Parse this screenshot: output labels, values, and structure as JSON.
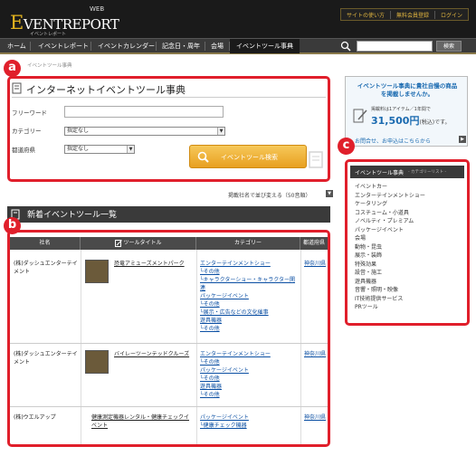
{
  "header": {
    "logo_web": "WEB",
    "logo_e": "E",
    "logo_rest": "VENT",
    "logo_report": "REPORT",
    "logo_tagline": "イベントレポート",
    "util_links": [
      "サイトの使い方",
      "無料会員登録",
      "ログイン"
    ]
  },
  "nav": {
    "items": [
      "ホーム",
      "イベントレポート",
      "イベントカレンダー",
      "記念日・周年",
      "会場",
      "イベントツール事典"
    ],
    "search_button": "検索"
  },
  "breadcrumb": "イベントツール事典",
  "markers": {
    "a": "a",
    "b": "b",
    "c": "c"
  },
  "search_panel": {
    "title": "インターネットイベントツール事典",
    "label_freeword": "フリーワード",
    "label_category": "カテゴリー",
    "label_prefecture": "都道府県",
    "category_selected": "指定なし",
    "prefecture_selected": "指定なし",
    "search_button": "イベントツール検索"
  },
  "sort_link": "掲載社名で並び変える（50音順）",
  "list_header": "新着イベントツール一覧",
  "table": {
    "columns": [
      "社名",
      "ツールタイトル",
      "カテゴリー",
      "都道府県"
    ],
    "rows": [
      {
        "company": "(株)ダッシュエンターテイメント",
        "title": "恐竜アミューズメントパーク",
        "categories": [
          "エンターテインメントショー",
          "└その他",
          "└キャラクターショー・キャラクター関連",
          "パッケージイベント",
          "└その他",
          "└展示・広告などの文化催事",
          "遊具機器",
          "└その他"
        ],
        "prefecture": "神奈川県"
      },
      {
        "company": "(株)ダッシュエンターテイメント",
        "title": "バイレーツーンテッドクルーズ",
        "categories": [
          "エンターテインメントショー",
          "└その他",
          "パッケージイベント",
          "└その他",
          "遊具機器",
          "└その他"
        ],
        "prefecture": "神奈川県"
      },
      {
        "company": "(株)ウエルアップ",
        "title": "健康測定機器レンタル・健康チェックイベント",
        "categories": [
          "パッケージイベント",
          "└健康チェック機器"
        ],
        "prefecture": "神奈川県"
      }
    ]
  },
  "ad": {
    "title": "イベントツール事典に貴社自慢の商品を掲載しませんか。",
    "fee_note": "掲載料は1アイテム／1年間で",
    "price": "31,500円",
    "price_suffix": "(税込)です。",
    "link": "お問合せ、お申込はこちらから"
  },
  "category_list": {
    "title": "イベントツール事典",
    "subtitle": "- カテゴリーリスト -",
    "items": [
      "イベントカー",
      "エンターテインメントショー",
      "ケータリング",
      "コスチューム・小道具",
      "ノベルティ・プレミアム",
      "パッケージイベント",
      "会場",
      "動物・昆虫",
      "展示・装飾",
      "特殊効果",
      "設営・施工",
      "遊具機器",
      "音響・照明・映像",
      "IT技術提供サービス",
      "PRツール"
    ]
  },
  "colors": {
    "annotation_red": "#e01f2b",
    "link_blue": "#0b4fa3",
    "accent_gold": "#e5b51e",
    "search_orange": "#e8a020"
  }
}
